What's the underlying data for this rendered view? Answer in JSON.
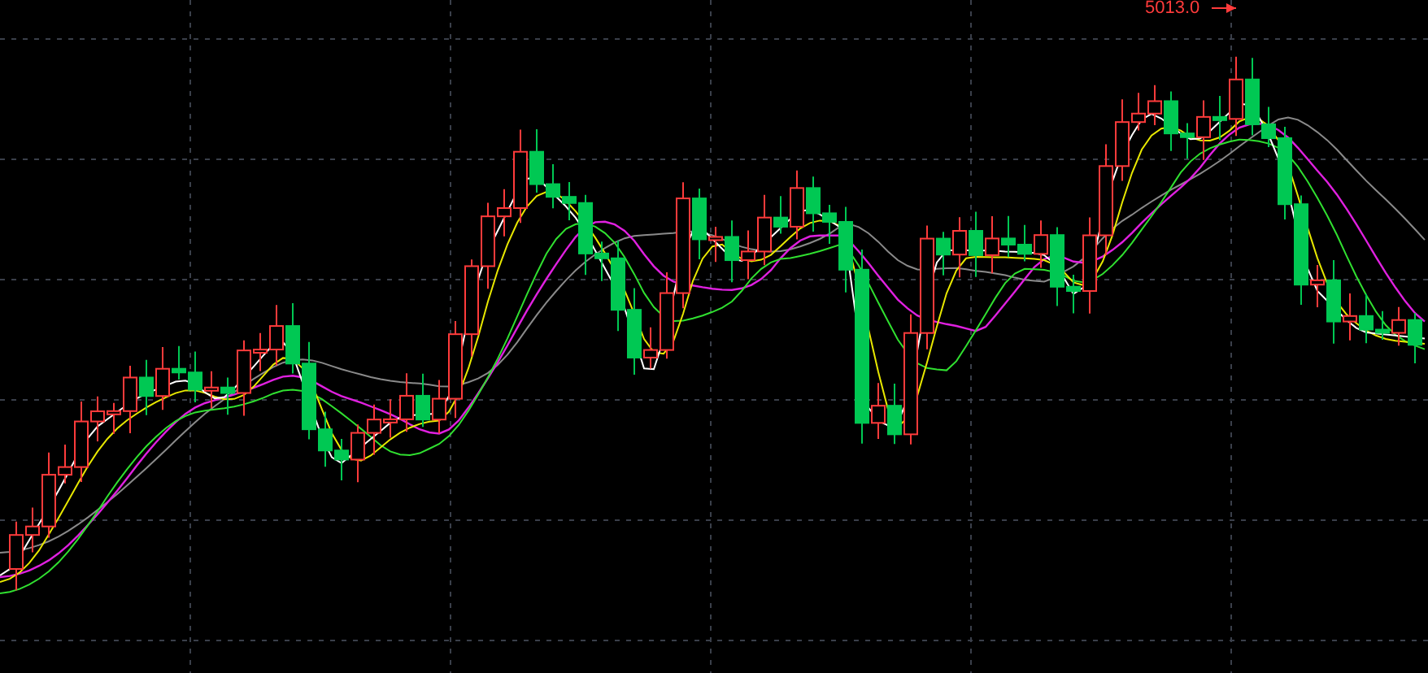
{
  "chart": {
    "high_label": "5013.0"
  }
}
